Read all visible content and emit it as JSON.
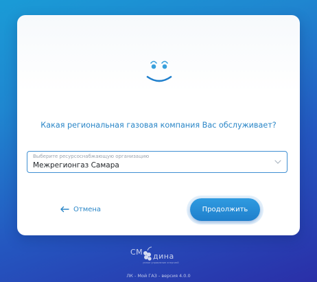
{
  "dialog": {
    "question": "Какая региональная газовая компания Вас обслуживает?",
    "select": {
      "label": "Выберите ресурсоснабжающую организацию",
      "value": "Межрегионгаз Самара"
    },
    "cancel_label": "Отмена",
    "continue_label": "Продолжить"
  },
  "brand": {
    "logo_left": "СМ",
    "logo_right": "дина",
    "logo_tagline": "умное управление энергией"
  },
  "footer": {
    "version": "ЛК - Мой ГАЗ - версия 4.0.0"
  },
  "colors": {
    "accent": "#2a86c7",
    "button": "#1f7fcc",
    "background_top": "#1a9bd6",
    "background_bottom": "#2a2fa8"
  }
}
